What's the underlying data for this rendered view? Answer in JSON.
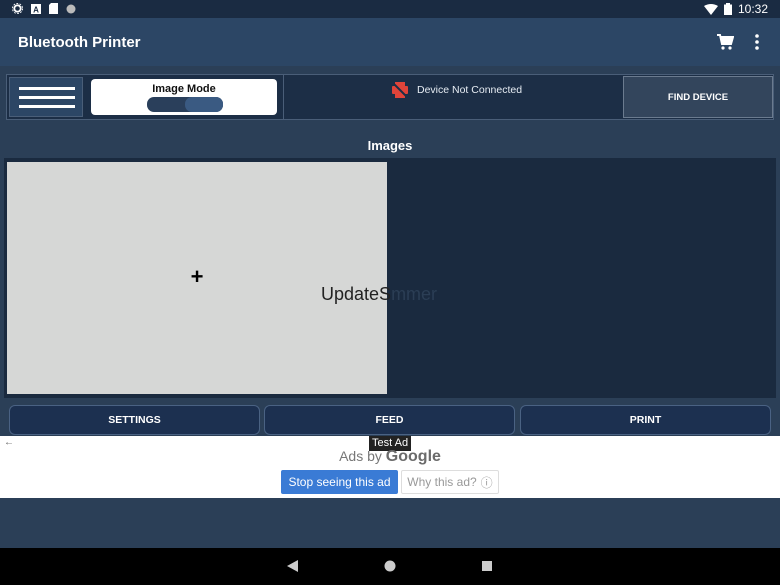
{
  "status_bar": {
    "time": "10:32",
    "icons": [
      "gear-icon",
      "text-a-icon",
      "sd-card-icon",
      "circle-icon",
      "wifi-icon",
      "battery-icon"
    ]
  },
  "app_bar": {
    "title": "Bluetooth Printer",
    "icons": [
      "cart-icon",
      "more-vert-icon"
    ]
  },
  "toolbar": {
    "mode_label": "Image Mode",
    "device_status": "Device Not Connected",
    "find_device_label": "FIND DEVICE"
  },
  "images": {
    "title": "Images",
    "add_symbol": "+",
    "overlay_text_start": "UpdateS",
    "overlay_text_end": "mmer"
  },
  "actions": {
    "settings_label": "SETTINGS",
    "feed_label": "FEED",
    "print_label": "PRINT"
  },
  "ad": {
    "back_symbol": "←",
    "test_ad_label": "Test Ad",
    "ads_by": "Ads by",
    "ads_by_brand": "Google",
    "stop_label": "Stop seeing this ad",
    "why_label": "Why this ad?",
    "why_icon": "ⓘ"
  },
  "colors": {
    "background": "#2b3f57",
    "app_bar": "#2c4665",
    "accent_blue": "#3a7bd5",
    "no_device_red": "#e0443a"
  }
}
